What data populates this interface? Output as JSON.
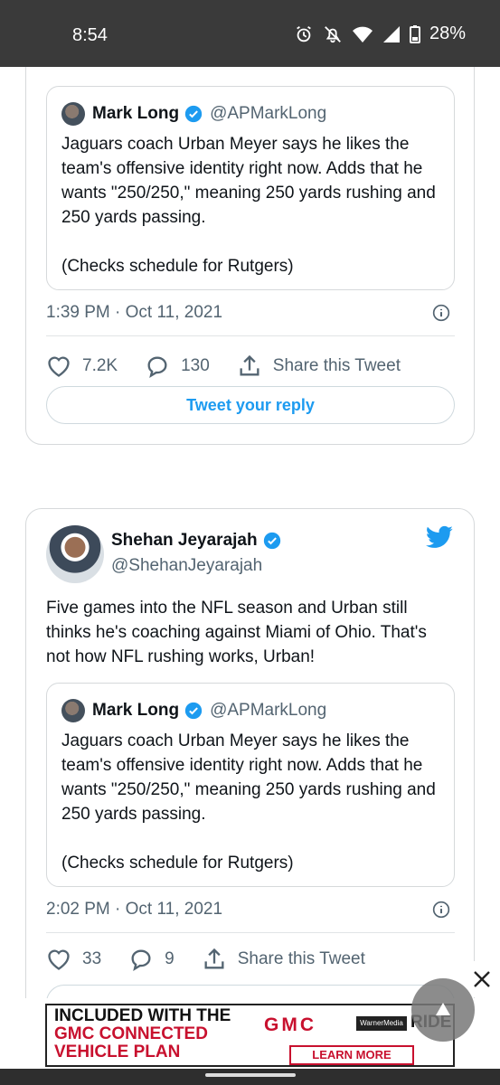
{
  "status_bar": {
    "time": "8:54",
    "battery": "28%",
    "icons": [
      "alarm-icon",
      "bell-off-icon",
      "wifi-icon",
      "signal-icon",
      "battery-icon"
    ]
  },
  "tweet1": {
    "quoted": {
      "name": "Mark Long",
      "handle": "@APMarkLong",
      "text": "Jaguars coach Urban Meyer says he likes the team's offensive identity right now. Adds that he wants \"250/250,\" meaning 250 yards rushing and 250 yards passing.\n\n(Checks schedule for Rutgers)"
    },
    "timestamp": "1:39 PM · Oct 11, 2021",
    "likes": "7.2K",
    "replies": "130",
    "share_label": "Share this Tweet",
    "reply_label": "Tweet your reply"
  },
  "tweet2": {
    "name": "Shehan Jeyarajah",
    "handle": "@ShehanJeyarajah",
    "text": "Five games into the NFL season and Urban still thinks he's coaching against Miami of Ohio. That's not how NFL rushing works, Urban!",
    "quoted": {
      "name": "Mark Long",
      "handle": "@APMarkLong",
      "text": "Jaguars coach Urban Meyer says he likes the team's offensive identity right now. Adds that he wants \"250/250,\" meaning 250 yards rushing and 250 yards passing.\n\n(Checks schedule for Rutgers)"
    },
    "timestamp": "2:02 PM · Oct 11, 2021",
    "likes": "33",
    "replies": "9",
    "share_label": "Share this Tweet"
  },
  "ad": {
    "line1": "INCLUDED WITH THE",
    "line2": "GMC CONNECTED",
    "line3": "VEHICLE PLAN",
    "brand": "GMC",
    "partner": "WarnerMedia",
    "ride": "RIDE",
    "cta": "LEARN MORE"
  },
  "colors": {
    "accent": "#1d9bf0",
    "ad_red": "#c8102e"
  }
}
